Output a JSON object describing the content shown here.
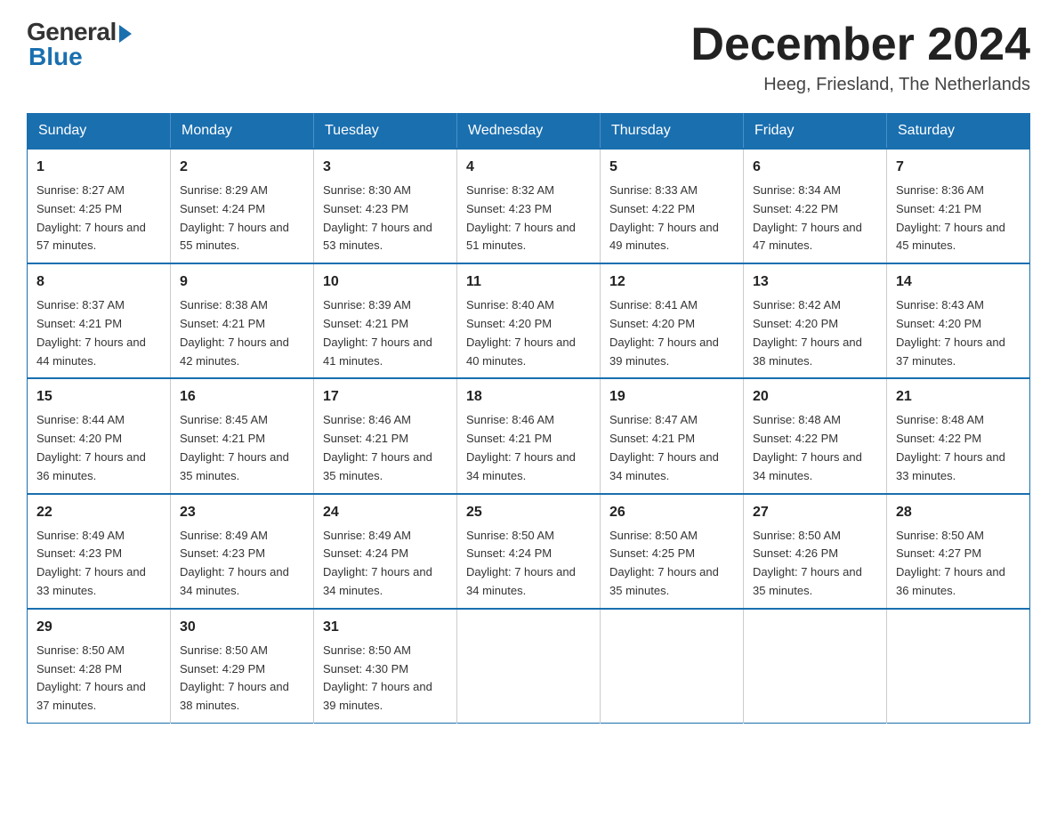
{
  "logo": {
    "general": "General",
    "blue": "Blue"
  },
  "title": "December 2024",
  "subtitle": "Heeg, Friesland, The Netherlands",
  "days_of_week": [
    "Sunday",
    "Monday",
    "Tuesday",
    "Wednesday",
    "Thursday",
    "Friday",
    "Saturday"
  ],
  "weeks": [
    [
      {
        "day": "1",
        "sunrise": "8:27 AM",
        "sunset": "4:25 PM",
        "daylight": "7 hours and 57 minutes."
      },
      {
        "day": "2",
        "sunrise": "8:29 AM",
        "sunset": "4:24 PM",
        "daylight": "7 hours and 55 minutes."
      },
      {
        "day": "3",
        "sunrise": "8:30 AM",
        "sunset": "4:23 PM",
        "daylight": "7 hours and 53 minutes."
      },
      {
        "day": "4",
        "sunrise": "8:32 AM",
        "sunset": "4:23 PM",
        "daylight": "7 hours and 51 minutes."
      },
      {
        "day": "5",
        "sunrise": "8:33 AM",
        "sunset": "4:22 PM",
        "daylight": "7 hours and 49 minutes."
      },
      {
        "day": "6",
        "sunrise": "8:34 AM",
        "sunset": "4:22 PM",
        "daylight": "7 hours and 47 minutes."
      },
      {
        "day": "7",
        "sunrise": "8:36 AM",
        "sunset": "4:21 PM",
        "daylight": "7 hours and 45 minutes."
      }
    ],
    [
      {
        "day": "8",
        "sunrise": "8:37 AM",
        "sunset": "4:21 PM",
        "daylight": "7 hours and 44 minutes."
      },
      {
        "day": "9",
        "sunrise": "8:38 AM",
        "sunset": "4:21 PM",
        "daylight": "7 hours and 42 minutes."
      },
      {
        "day": "10",
        "sunrise": "8:39 AM",
        "sunset": "4:21 PM",
        "daylight": "7 hours and 41 minutes."
      },
      {
        "day": "11",
        "sunrise": "8:40 AM",
        "sunset": "4:20 PM",
        "daylight": "7 hours and 40 minutes."
      },
      {
        "day": "12",
        "sunrise": "8:41 AM",
        "sunset": "4:20 PM",
        "daylight": "7 hours and 39 minutes."
      },
      {
        "day": "13",
        "sunrise": "8:42 AM",
        "sunset": "4:20 PM",
        "daylight": "7 hours and 38 minutes."
      },
      {
        "day": "14",
        "sunrise": "8:43 AM",
        "sunset": "4:20 PM",
        "daylight": "7 hours and 37 minutes."
      }
    ],
    [
      {
        "day": "15",
        "sunrise": "8:44 AM",
        "sunset": "4:20 PM",
        "daylight": "7 hours and 36 minutes."
      },
      {
        "day": "16",
        "sunrise": "8:45 AM",
        "sunset": "4:21 PM",
        "daylight": "7 hours and 35 minutes."
      },
      {
        "day": "17",
        "sunrise": "8:46 AM",
        "sunset": "4:21 PM",
        "daylight": "7 hours and 35 minutes."
      },
      {
        "day": "18",
        "sunrise": "8:46 AM",
        "sunset": "4:21 PM",
        "daylight": "7 hours and 34 minutes."
      },
      {
        "day": "19",
        "sunrise": "8:47 AM",
        "sunset": "4:21 PM",
        "daylight": "7 hours and 34 minutes."
      },
      {
        "day": "20",
        "sunrise": "8:48 AM",
        "sunset": "4:22 PM",
        "daylight": "7 hours and 34 minutes."
      },
      {
        "day": "21",
        "sunrise": "8:48 AM",
        "sunset": "4:22 PM",
        "daylight": "7 hours and 33 minutes."
      }
    ],
    [
      {
        "day": "22",
        "sunrise": "8:49 AM",
        "sunset": "4:23 PM",
        "daylight": "7 hours and 33 minutes."
      },
      {
        "day": "23",
        "sunrise": "8:49 AM",
        "sunset": "4:23 PM",
        "daylight": "7 hours and 34 minutes."
      },
      {
        "day": "24",
        "sunrise": "8:49 AM",
        "sunset": "4:24 PM",
        "daylight": "7 hours and 34 minutes."
      },
      {
        "day": "25",
        "sunrise": "8:50 AM",
        "sunset": "4:24 PM",
        "daylight": "7 hours and 34 minutes."
      },
      {
        "day": "26",
        "sunrise": "8:50 AM",
        "sunset": "4:25 PM",
        "daylight": "7 hours and 35 minutes."
      },
      {
        "day": "27",
        "sunrise": "8:50 AM",
        "sunset": "4:26 PM",
        "daylight": "7 hours and 35 minutes."
      },
      {
        "day": "28",
        "sunrise": "8:50 AM",
        "sunset": "4:27 PM",
        "daylight": "7 hours and 36 minutes."
      }
    ],
    [
      {
        "day": "29",
        "sunrise": "8:50 AM",
        "sunset": "4:28 PM",
        "daylight": "7 hours and 37 minutes."
      },
      {
        "day": "30",
        "sunrise": "8:50 AM",
        "sunset": "4:29 PM",
        "daylight": "7 hours and 38 minutes."
      },
      {
        "day": "31",
        "sunrise": "8:50 AM",
        "sunset": "4:30 PM",
        "daylight": "7 hours and 39 minutes."
      },
      null,
      null,
      null,
      null
    ]
  ]
}
